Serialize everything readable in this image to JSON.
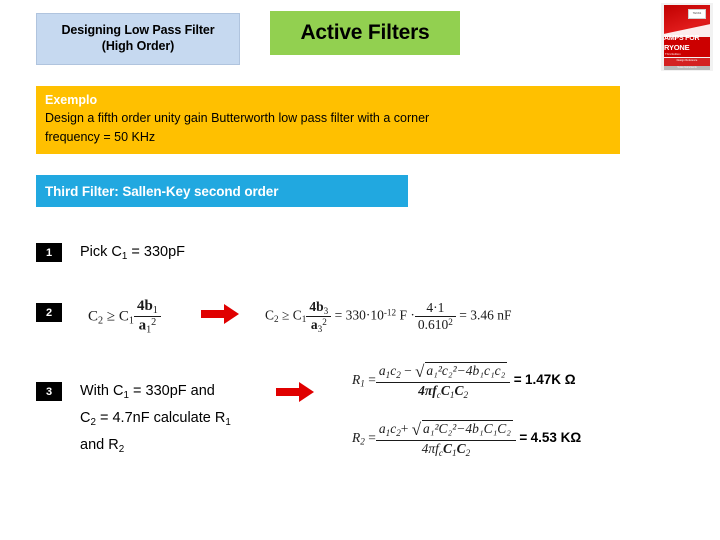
{
  "slide": {
    "title_line1": "Designing Low Pass Filter",
    "title_line2": "(High Order)",
    "subject": "Active Filters"
  },
  "book_cover": {
    "name": "op-amps-for-everyone-book-cover",
    "title_line1": "AMPS FOR",
    "title_line2": "RYONE",
    "subtitle": "Third Edition",
    "band_text": "Design Reference",
    "footer_text": "Texas Instruments",
    "chip_text": "TEXAS",
    "accent_color": "#cc0000"
  },
  "example": {
    "heading": "Exemplo",
    "line1": "Design a fifth order unity gain  Butterworth low pass filter with a corner",
    "line2": "frequency = 50 KHz",
    "background_color": "#ffc000"
  },
  "section": {
    "label": "Third Filter: Sallen-Key second  order",
    "background_color": "#21a8e0"
  },
  "steps": [
    {
      "number": "1",
      "text": "Pick C",
      "text_sub": "1",
      "text_tail": " = 330pF"
    },
    {
      "number": "2",
      "formula_left": "C₂ ≥ C₁ · 4b₁ / a₁²",
      "formula_right": "C₂ ≥ C₁ · 4b₃ / a₃² = 330·10⁻¹² F · 4·1 / 0.610² = 3.46 nF"
    },
    {
      "number": "3",
      "line1_a": "With C",
      "line1_sub": "1",
      "line1_b": " = 330pF and",
      "line2_a": "C",
      "line2_sub": "2",
      "line2_b": " = 4.7nF calculate R",
      "line2_sub2": "1",
      "line3": "and R",
      "line3_sub": "2"
    }
  ],
  "math": {
    "c2_left": {
      "lhs": "C",
      "lhs_sub": "2",
      "rel": "≥",
      "c1": "C",
      "c1_sub": "1",
      "num": "4b",
      "num_sub": "1",
      "den": "a",
      "den_sub": "1",
      "den_sup": "2"
    },
    "c2_right": {
      "lhs": "C",
      "lhs_sub": "2",
      "rel": "≥",
      "c1": "C",
      "c1_sub": "1",
      "num": "4b",
      "num_sub": "3",
      "den": "a",
      "den_sub": "3",
      "den_sup": "2",
      "eq1": "=",
      "coef": "330·10",
      "coef_exp": "-12",
      "unit": "F ·",
      "num2": "4·1",
      "den2": "0.610",
      "den2_sup": "2",
      "eq2": "=",
      "result": "3.46 nF"
    },
    "r1": {
      "lhs": "R",
      "lhs_sub": "1",
      "eq": "=",
      "num_a": "a",
      "num_a_sub": "1",
      "num_c": "c",
      "num_c_sub": "2",
      "minus": "−",
      "radicand": "a₁²c₂²−4b₁c₁c₂",
      "den": "4πf",
      "den_sub": "c",
      "den_c1": "C",
      "den_c1_sub": "1",
      "den_c2": "C",
      "den_c2_sub": "2",
      "result_eq": "=",
      "result": "1.47K Ω"
    },
    "r2": {
      "lhs": "R",
      "lhs_sub": "2",
      "eq": "=",
      "num_a": "a",
      "num_a_sub": "1",
      "num_c": "c",
      "num_c_sub": "2",
      "plus": "+",
      "radicand": "a₁²C₂²−4b₁C₁C₂",
      "den": "4πf",
      "den_sub": "c",
      "den_c1": "C",
      "den_c1_sub": "1",
      "den_c2": "C",
      "den_c2_sub": "2",
      "result_eq": "=",
      "result": "4.53 KΩ"
    }
  },
  "arrows": {
    "color": "#e00000",
    "step2_name": "red-arrow-icon",
    "step3_name": "red-arrow-icon"
  }
}
